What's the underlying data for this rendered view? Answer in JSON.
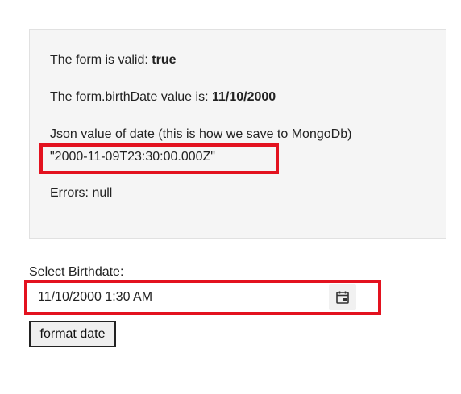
{
  "status": {
    "valid_prefix": "The form is valid: ",
    "valid_value": "true",
    "birthdate_prefix": "The form.birthDate value is: ",
    "birthdate_value": "11/10/2000",
    "json_label": "Json value of date (this is how we save to MongoDb)",
    "json_value": "\"2000-11-09T23:30:00.000Z\"",
    "errors_text": "Errors: null"
  },
  "form": {
    "select_label": "Select Birthdate:",
    "date_value": "11/10/2000 1:30 AM",
    "format_button_label": "format date"
  },
  "icons": {
    "calendar": "calendar-icon"
  },
  "colors": {
    "highlight": "#e3121f",
    "panel_bg": "#f5f5f5"
  }
}
